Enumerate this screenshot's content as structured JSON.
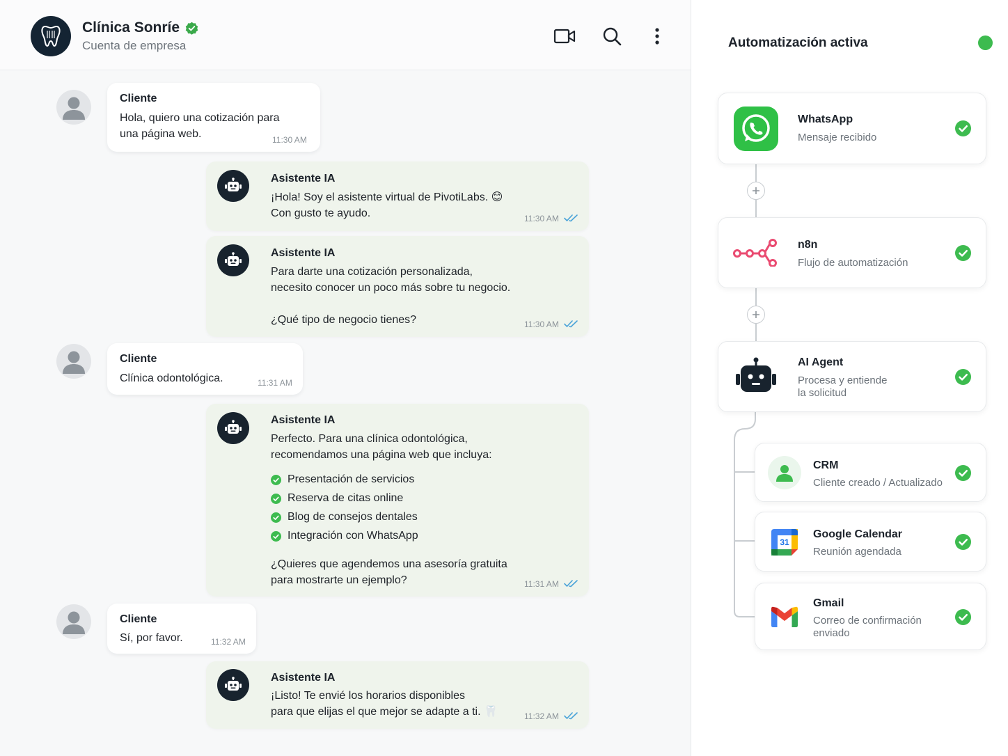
{
  "chat": {
    "contact": {
      "name": "Clínica Sonríe",
      "subtitle": "Cuenta de empresa",
      "logo_icon": "tooth-icon",
      "verified_icon": "verified-badge-icon"
    },
    "header_icons": [
      "video-call-icon",
      "search-icon",
      "more-vertical-icon"
    ],
    "messages": [
      {
        "from": "client",
        "sender": "Cliente",
        "lines": [
          "Hola, quiero una cotización para",
          "una página web."
        ],
        "time": "11:30 AM"
      },
      {
        "from": "bot",
        "sender": "Asistente IA",
        "lines": [
          "¡Hola! Soy el asistente virtual de PivotiLabs. 😊",
          "Con gusto te ayudo."
        ],
        "time": "11:30 AM"
      },
      {
        "from": "bot",
        "sender": "Asistente IA",
        "lines": [
          "Para darte una cotización personalizada,",
          "necesito conocer un poco más sobre tu negocio.",
          "¿Qué tipo de negocio tienes?"
        ],
        "time": "11:30 AM"
      },
      {
        "from": "client",
        "sender": "Cliente",
        "lines": [
          "Clínica odontológica."
        ],
        "time": "11:31 AM"
      },
      {
        "from": "bot",
        "sender": "Asistente IA",
        "lines": [
          "Perfecto. Para una clínica odontológica,",
          "recomendamos una página web que incluya:"
        ],
        "checklist": [
          "Presentación de servicios",
          "Reserva de citas online",
          "Blog de consejos dentales",
          "Integración con WhatsApp"
        ],
        "closing": [
          "¿Quieres que agendemos una asesoría gratuita",
          "para mostrarte un ejemplo?"
        ],
        "time": "11:31 AM"
      },
      {
        "from": "client",
        "sender": "Cliente",
        "lines": [
          "Sí, por favor."
        ],
        "time": "11:32 AM"
      },
      {
        "from": "bot",
        "sender": "Asistente IA",
        "lines": [
          "¡Listo! Te envié los horarios disponibles",
          "para que elijas el que mejor se adapte a ti. 🦷"
        ],
        "time": "11:32 AM"
      }
    ]
  },
  "automation": {
    "title": "Automatización activa",
    "status_color": "#3dbb4f",
    "steps": [
      {
        "title": "WhatsApp",
        "subtitle": [
          "Mensaje recibido"
        ],
        "icon": "whatsapp-icon"
      },
      {
        "title": "n8n",
        "subtitle": [
          "Flujo de automatización"
        ],
        "icon": "n8n-icon"
      },
      {
        "title": "AI Agent",
        "subtitle": [
          "Procesa y entiende",
          "la solicitud"
        ],
        "icon": "robot-icon"
      }
    ],
    "branches": [
      {
        "title": "CRM",
        "subtitle": [
          "Cliente creado / Actualizado"
        ],
        "icon": "user-icon"
      },
      {
        "title": "Google Calendar",
        "subtitle": [
          "Reunión agendada"
        ],
        "icon": "calendar-icon",
        "calendar_day": "31"
      },
      {
        "title": "Gmail",
        "subtitle": [
          "Correo de confirmación",
          "enviado"
        ],
        "icon": "gmail-icon"
      }
    ]
  }
}
